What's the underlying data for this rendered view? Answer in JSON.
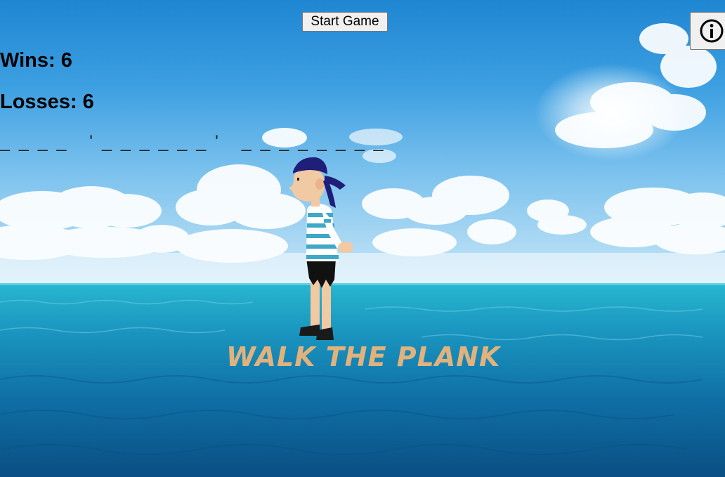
{
  "toolbar": {
    "start_label": "Start Game",
    "info_icon": "info-circle-icon"
  },
  "stats": {
    "wins_label": "Wins: 6",
    "losses_label": "Losses: 6"
  },
  "puzzle": {
    "word_display": "_ _ _ _   ' _ _ _ _ _ _ '   _ _ _ _ _ _ _ _"
  },
  "game": {
    "title": "WALK THE PLANK",
    "character": "pirate-character"
  },
  "colors": {
    "title": "#e2b27c",
    "bandana": "#1f1f7a",
    "shirt_stripe": "#3fa8c9",
    "sea_top": "#27b6cf",
    "sea_bottom": "#0a4f83",
    "sky_top": "#1f86d2"
  }
}
